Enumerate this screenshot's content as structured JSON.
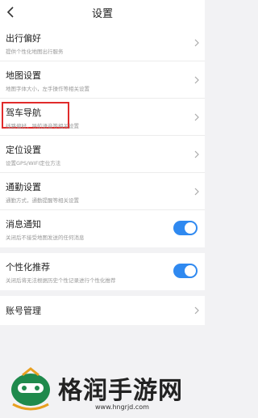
{
  "header": {
    "title": "设置"
  },
  "rows": [
    {
      "title": "出行偏好",
      "sub": "提供个性化地图出行服务"
    },
    {
      "title": "地图设置",
      "sub": "地图字体大小，左手操作等相关设置"
    },
    {
      "title": "驾车导航",
      "sub": "线路偏好，导航语音等相关设置"
    },
    {
      "title": "定位设置",
      "sub": "设置GPS/WIFI定位方法"
    },
    {
      "title": "通勤设置",
      "sub": "通勤方式，通勤提醒等相关设置"
    },
    {
      "title": "消息通知",
      "sub": "关闭后不接受地图发送的任何消息",
      "toggle": true
    },
    {
      "title": "个性化推荐",
      "sub": "关闭后将无法根据历史个性记录进行个性化推荐",
      "toggle": true
    },
    {
      "title": "账号管理"
    }
  ],
  "watermark": {
    "text": "格润手游网",
    "url": "www.hngrjd.com"
  },
  "colors": {
    "accent": "#2f89f0",
    "highlight": "#e02b2b"
  }
}
